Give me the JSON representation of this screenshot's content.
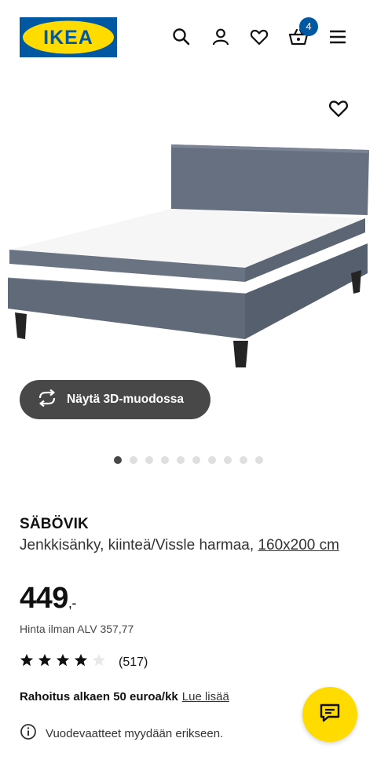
{
  "header": {
    "logo_text": "IKEA",
    "cart_count": "4",
    "icons": [
      "search-icon",
      "account-icon",
      "heart-icon",
      "cart-icon",
      "menu-icon"
    ]
  },
  "gallery": {
    "view_3d_label": "Näytä 3D-muodossa",
    "image_count": 10,
    "active_index": 0
  },
  "product": {
    "name": "SÄBÖVIK",
    "description": "Jenkkisänky, kiinteä/Vissle harmaa, ",
    "size": "160x200 cm",
    "price_main": "449",
    "price_suffix": ",-",
    "price_excl_vat": "Hinta ilman ALV 357,77",
    "rating_stars": 4,
    "rating_max": 5,
    "review_count": "(517)",
    "finance_text": "Rahoitus alkaen 50 euroa/kk",
    "finance_link": "Lue lisää",
    "notice": "Vuodevaatteet myydään erikseen."
  },
  "colors": {
    "ikea_blue": "#0058a3",
    "ikea_yellow": "#ffdb00",
    "dark_button": "#484848",
    "bed_fabric": "#6b7280"
  }
}
